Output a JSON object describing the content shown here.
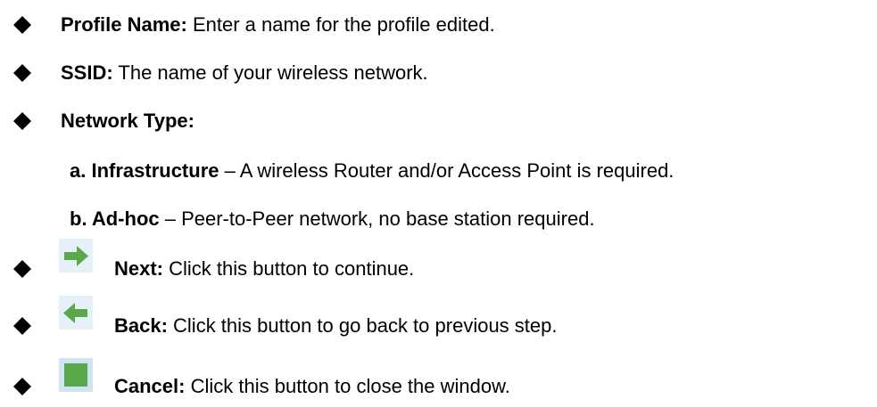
{
  "items": [
    {
      "term": "Profile Name:",
      "desc": " Enter a name for the profile edited."
    },
    {
      "term": "SSID:",
      "desc": " The name of your wireless network."
    },
    {
      "term": "Network Type:",
      "desc": ""
    }
  ],
  "network_types": [
    {
      "term": "a. Infrastructure",
      "desc": " – A wireless Router and/or Access Point is required."
    },
    {
      "term": "b. Ad-hoc",
      "desc": " – Peer-to-Peer network, no base station required."
    }
  ],
  "buttons": [
    {
      "icon": "next-arrow-icon",
      "term": "Next:",
      "desc": " Click this button to continue."
    },
    {
      "icon": "back-arrow-icon",
      "term": "Back:",
      "desc": " Click this button to go back to previous step."
    },
    {
      "icon": "cancel-square-icon",
      "term": "Cancel:",
      "desc": " Click this button to close the window."
    }
  ],
  "colors": {
    "icon_green": "#5aa84a",
    "icon_bg": "#cfe3f3"
  }
}
